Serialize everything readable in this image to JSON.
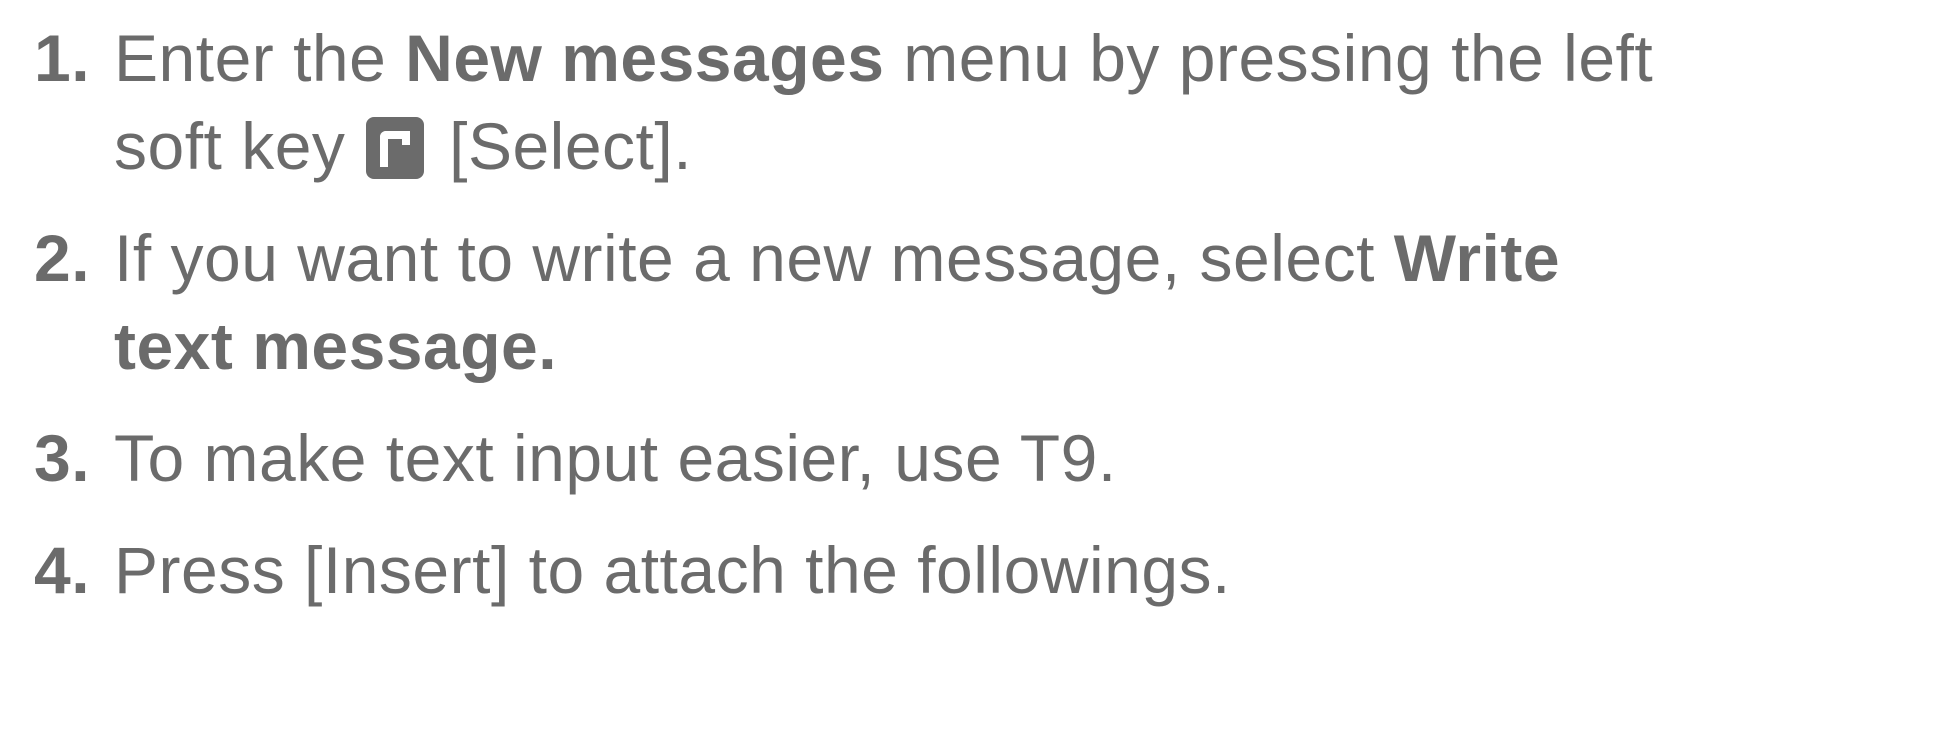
{
  "steps": [
    {
      "number": "1.",
      "parts": {
        "a": "Enter the ",
        "b": "New  messages",
        "c": " menu by pressing the left",
        "d": "soft key ",
        "icon": "left-soft-key-icon",
        "e": " [Select]."
      }
    },
    {
      "number": "2.",
      "parts": {
        "a": "If you want to write a new message, select ",
        "b": "Write",
        "c": "text message."
      }
    },
    {
      "number": "3.",
      "parts": {
        "a": "To make text input easier, use T9."
      }
    },
    {
      "number": "4.",
      "parts": {
        "a": "Press [Insert] to attach the followings."
      }
    }
  ]
}
